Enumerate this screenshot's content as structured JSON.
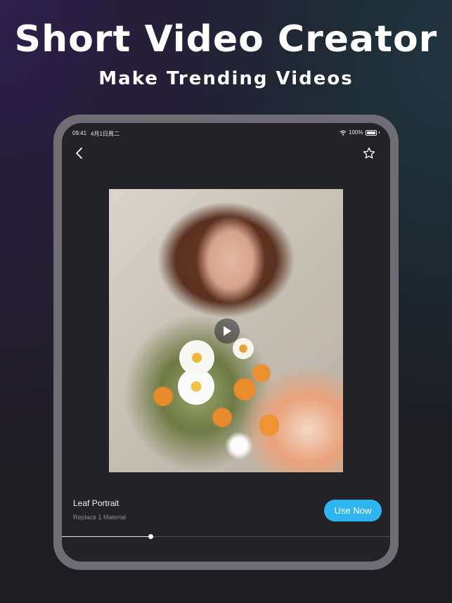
{
  "header": {
    "title": "Short Video Creator",
    "subtitle": "Make Trending Videos"
  },
  "status_bar": {
    "time": "09:41",
    "date": "4月1日周二",
    "battery": "100%"
  },
  "nav": {
    "back_icon": "chevron-left-icon",
    "favorite_icon": "star-outline-icon"
  },
  "preview": {
    "play_icon": "play-icon"
  },
  "template": {
    "name": "Leaf Portrait",
    "description": "Replace 1 Material",
    "action_label": "Use Now"
  },
  "playback": {
    "progress": 0.27
  },
  "colors": {
    "accent": "#2fb6f0",
    "screen_bg": "#232327",
    "frame": "#6e6d74"
  }
}
